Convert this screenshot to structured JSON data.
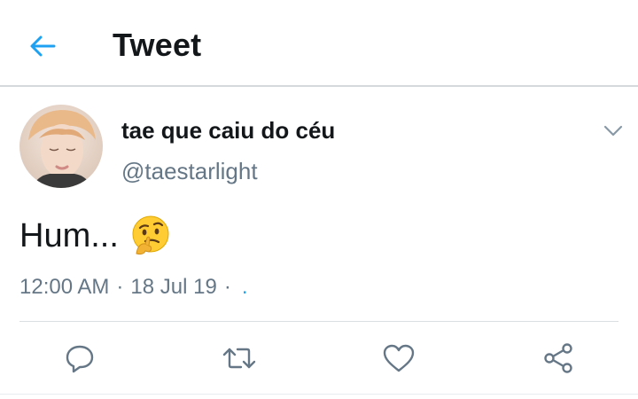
{
  "header": {
    "title": "Tweet",
    "back_icon": "arrow-left-icon",
    "accent": "#1da1f2"
  },
  "tweet": {
    "display_name": "tae que caiu do céu",
    "handle": "@taestarlight",
    "text": "Hum...",
    "emoji": "thinking-face-emoji",
    "time": "12:00 AM",
    "date": "18 Jul 19",
    "trailing_link": "."
  },
  "actions": [
    {
      "name": "reply",
      "icon": "reply-icon"
    },
    {
      "name": "retweet",
      "icon": "retweet-icon"
    },
    {
      "name": "like",
      "icon": "heart-icon"
    },
    {
      "name": "share",
      "icon": "share-icon"
    }
  ],
  "colors": {
    "text_primary": "#14171a",
    "text_secondary": "#657786",
    "divider": "#dcdfe2"
  }
}
